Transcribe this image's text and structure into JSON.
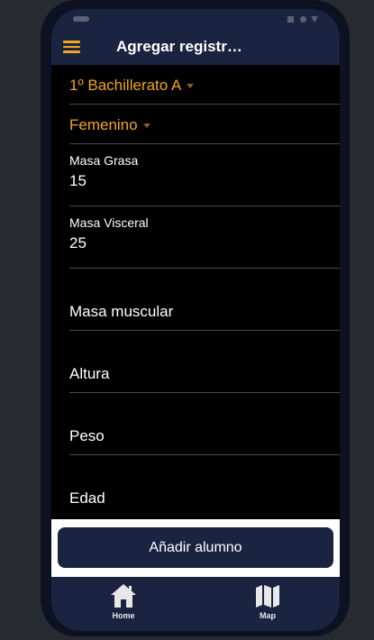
{
  "app": {
    "title": "Agregar registr…"
  },
  "form": {
    "group_select": "1º Bachillerato A",
    "gender_select": "Femenino",
    "fields": [
      {
        "label": "Masa Grasa",
        "value": "15"
      },
      {
        "label": "Masa Visceral",
        "value": "25"
      },
      {
        "label": "Masa muscular",
        "value": ""
      },
      {
        "label": "Altura",
        "value": ""
      },
      {
        "label": "Peso",
        "value": ""
      },
      {
        "label": "Edad",
        "value": ""
      }
    ],
    "submit_label": "Añadir alumno"
  },
  "nav": {
    "items": [
      {
        "label": "Home",
        "icon": "home-icon"
      },
      {
        "label": "Map",
        "icon": "map-icon"
      }
    ]
  },
  "colors": {
    "accent": "#f2a51d",
    "bar": "#1a2340",
    "background": "#000000"
  }
}
